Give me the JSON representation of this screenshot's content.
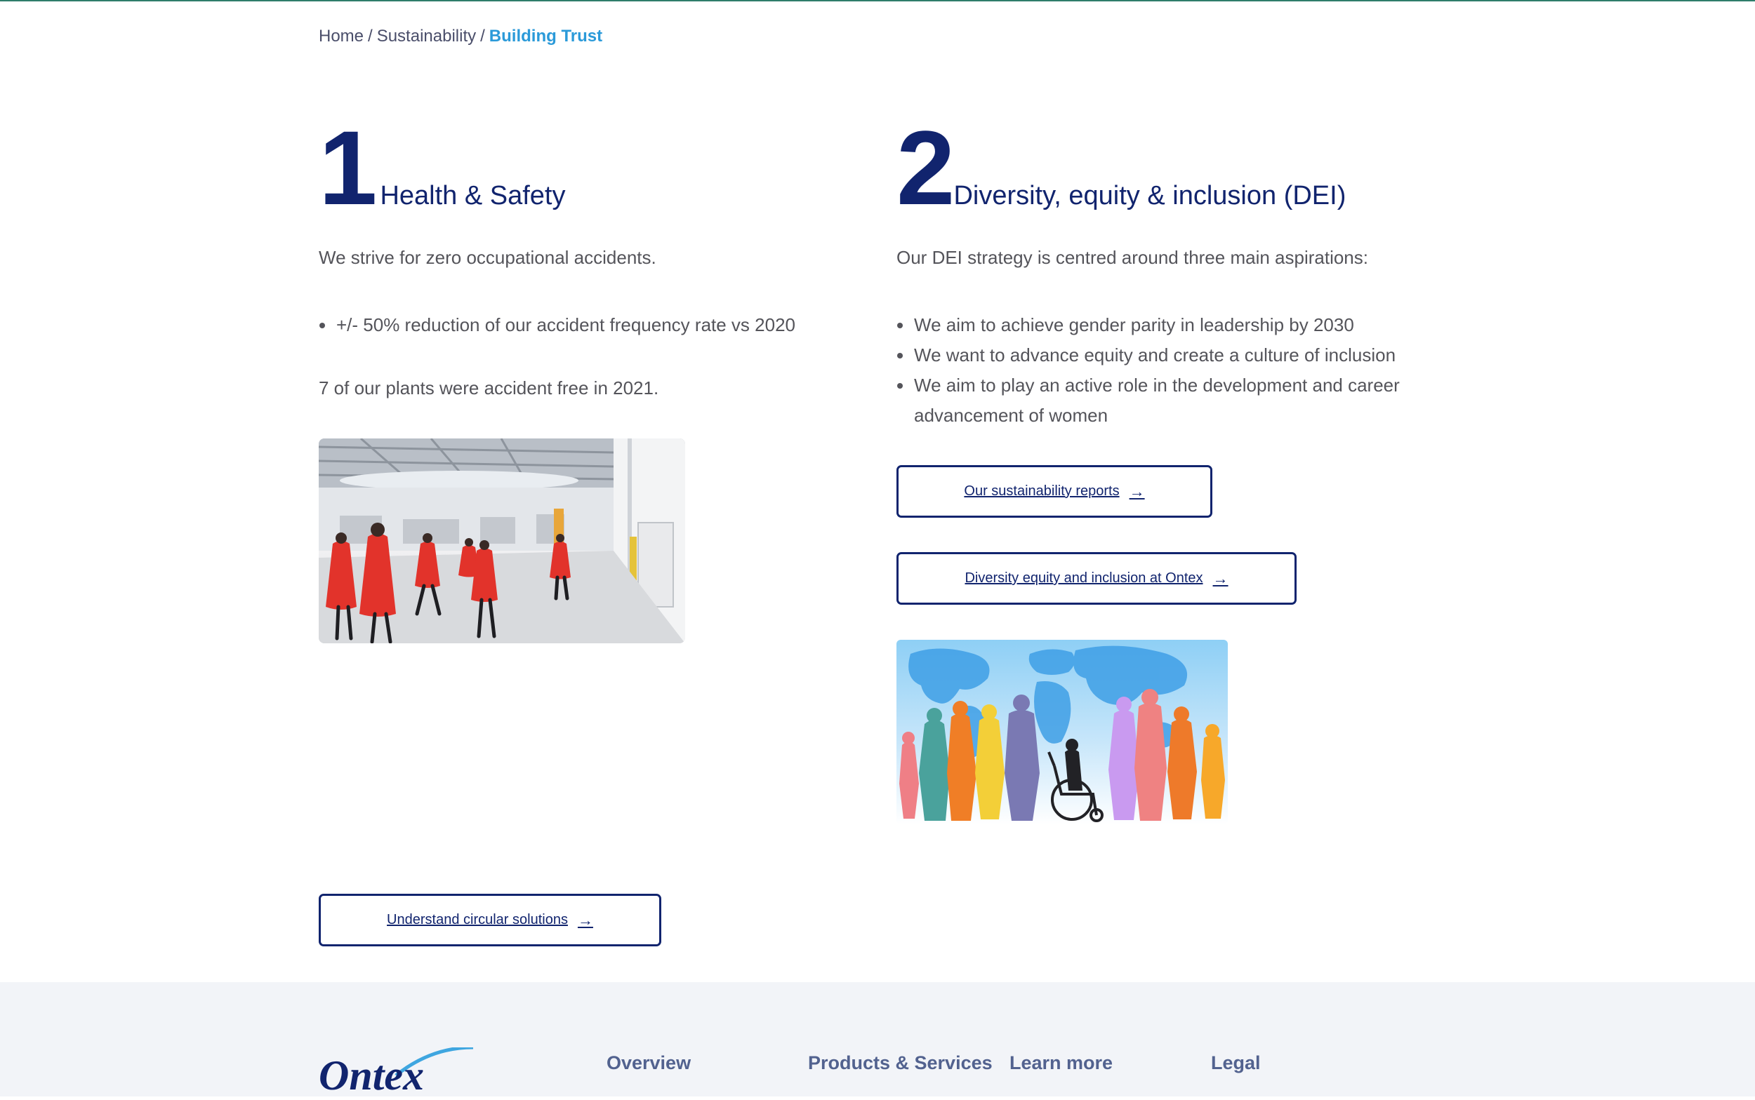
{
  "breadcrumb": {
    "home": "Home",
    "sustainability": "Sustainability",
    "current": "Building Trust",
    "separator": "/"
  },
  "sections": [
    {
      "number": "1",
      "title": "Health & Safety",
      "intro": "We strive for zero occupational accidents.",
      "points": [
        "+/- 50% reduction of our accident frequency rate vs 2020"
      ],
      "note": "7 of our plants were accident free in 2021."
    },
    {
      "number": "2",
      "title": "Diversity, equity & inclusion (DEI)",
      "intro": "Our DEI strategy is centred around three main aspirations:",
      "points": [
        "We aim to achieve gender parity in leadership by 2030",
        "We want to advance equity and create a culture of inclusion",
        "We aim to play an active role in the development and career advancement of women"
      ]
    }
  ],
  "buttons": {
    "reports": "Our sustainability reports",
    "dei": "Diversity equity and inclusion at Ontex",
    "circular": "Understand circular solutions",
    "arrow": "→"
  },
  "footer": {
    "logo_text": "Ontex",
    "nav": {
      "overview": "Overview",
      "products": "Products & Services",
      "learn": "Learn more",
      "legal": "Legal"
    }
  },
  "colors": {
    "brand_navy": "#11246e",
    "breadcrumb_accent": "#2b9ad9",
    "top_line": "#2e7d6a",
    "footer_bg": "#f2f4f8",
    "worker_coat": "#e2332b"
  },
  "icons": {
    "button_arrow": "arrow-right-icon"
  }
}
